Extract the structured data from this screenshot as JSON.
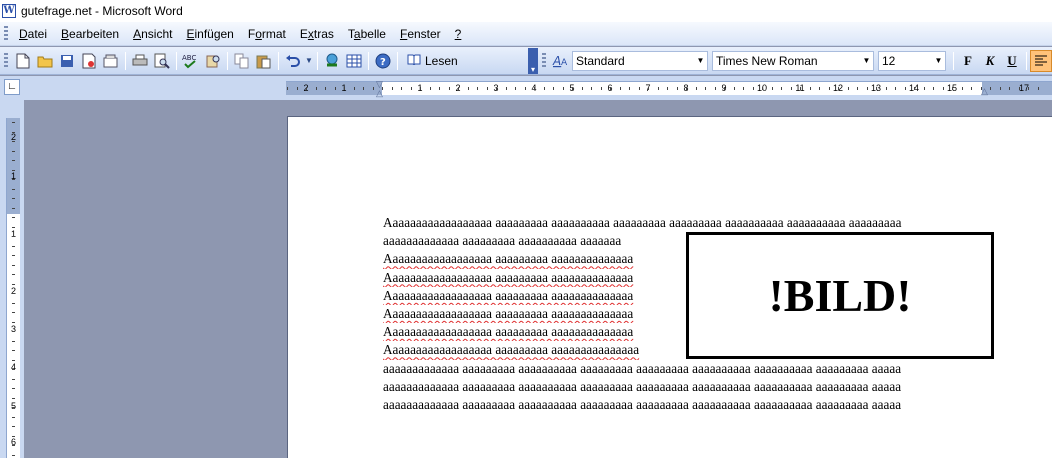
{
  "window": {
    "title": "gutefrage.net - Microsoft Word",
    "icon": "word-doc-icon"
  },
  "menu": {
    "items": [
      {
        "label": "Datei",
        "underline": "D"
      },
      {
        "label": "Bearbeiten",
        "underline": "B"
      },
      {
        "label": "Ansicht",
        "underline": "A"
      },
      {
        "label": "Einfügen",
        "underline": "E"
      },
      {
        "label": "Format",
        "underline": "o"
      },
      {
        "label": "Extras",
        "underline": "x"
      },
      {
        "label": "Tabelle",
        "underline": "a"
      },
      {
        "label": "Fenster",
        "underline": "F"
      },
      {
        "label": "?",
        "underline": "?"
      }
    ]
  },
  "toolbar": {
    "read_label": "Lesen",
    "style_value": "Standard",
    "font_value": "Times New Roman",
    "size_value": "12",
    "bold_label": "F",
    "italic_label": "K",
    "underline_label": "U",
    "icons": [
      "new-doc-icon",
      "open-folder-icon",
      "save-icon",
      "permission-icon",
      "email-icon",
      "print-icon",
      "print-preview-icon",
      "spellcheck-icon",
      "research-icon",
      "copy-icon",
      "paste-icon",
      "undo-icon",
      "hyperlink-icon",
      "table-icon",
      "help-icon",
      "read-icon",
      "style-a-icon",
      "align-left-icon"
    ]
  },
  "ruler": {
    "horizontal_labels": [
      "2",
      "1",
      "1",
      "2",
      "3",
      "4",
      "5",
      "6",
      "7",
      "8",
      "9",
      "10",
      "11",
      "12",
      "13",
      "14",
      "15",
      "17"
    ],
    "vertical_labels": [
      "2",
      "1",
      "1",
      "2",
      "3",
      "4",
      "5",
      "6"
    ]
  },
  "document": {
    "first_line": "Aaaaaaaaaaaaaaaaaa aaaaaaaaa aaaaaaaaaa aaaaaaaaa aaaaaaaaa aaaaaaaaaa aaaaaaaaaa aaaaaaaaa",
    "second_line": "aaaaaaaaaaaaa aaaaaaaaa aaaaaaaaaa aaaaaaa",
    "wrapped_lines": [
      "Aaaaaaaaaaaaaaaaaa aaaaaaaaa aaaaaaaaaaaaaa",
      "Aaaaaaaaaaaaaaaaaa aaaaaaaaa aaaaaaaaaaaaaa",
      "Aaaaaaaaaaaaaaaaaa aaaaaaaaa aaaaaaaaaaaaaa",
      "Aaaaaaaaaaaaaaaaaa aaaaaaaaa aaaaaaaaaaaaaa",
      "Aaaaaaaaaaaaaaaaaa aaaaaaaaa aaaaaaaaaaaaaa",
      "Aaaaaaaaaaaaaaaaaa aaaaaaaaa aaaaaaaaaaaaaaa"
    ],
    "full_lines": [
      "aaaaaaaaaaaaa aaaaaaaaa aaaaaaaaaa aaaaaaaaa aaaaaaaaa aaaaaaaaaa aaaaaaaaaa aaaaaaaaa aaaaa",
      "aaaaaaaaaaaaa aaaaaaaaa aaaaaaaaaa aaaaaaaaa aaaaaaaaa aaaaaaaaaa aaaaaaaaaa aaaaaaaaa aaaaa",
      "aaaaaaaaaaaaa aaaaaaaaa aaaaaaaaaa aaaaaaaaa aaaaaaaaa aaaaaaaaaa aaaaaaaaaa aaaaaaaaa aaaaa"
    ],
    "image_placeholder": "!BILD!"
  }
}
